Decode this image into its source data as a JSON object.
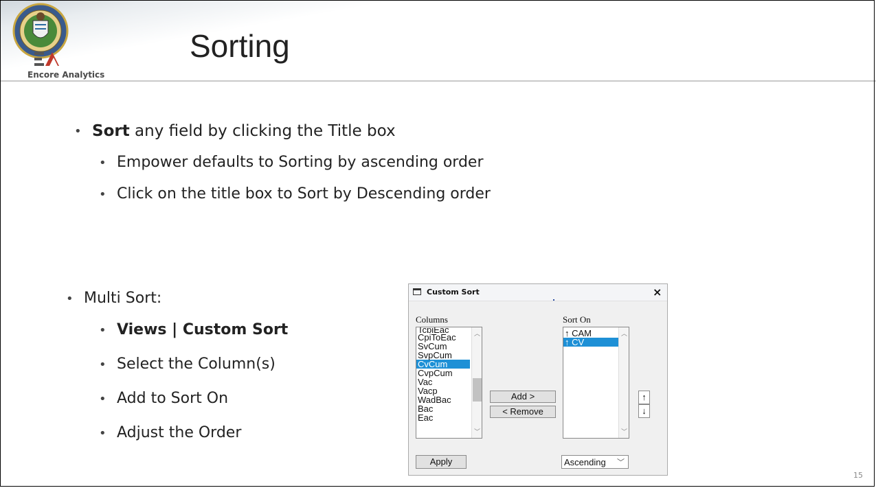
{
  "slide": {
    "title": "Sorting",
    "logo_text": "Encore Analytics",
    "page_number": "15"
  },
  "bullets": {
    "sort_bold": "Sort",
    "sort_rest": " any field by clicking the Title box",
    "sub1": "Empower defaults to Sorting by ascending order",
    "sub2": "Click on the title box to Sort by Descending order",
    "multi": "Multi Sort:",
    "views": "Views | Custom Sort",
    "select_cols": "Select the Column(s)",
    "add_to": "Add to Sort On",
    "adjust": "Adjust the Order"
  },
  "dialog": {
    "title": "Custom Sort",
    "close": "×",
    "columns_label": "Columns",
    "sort_on_label": "Sort On",
    "columns": [
      "CpiToEac",
      "SvCum",
      "SvpCum",
      "CvCum",
      "CvpCum",
      "Vac",
      "Vacp",
      "WadBac",
      "Bac",
      "Eac"
    ],
    "columns_top_clipped": "TcpiEac",
    "selected_column": "CvCum",
    "sort_on": [
      "↑ CAM",
      "↑ CV"
    ],
    "selected_sort": "↑ CV",
    "add_button": "Add >",
    "remove_button": "< Remove",
    "up_button": "↑",
    "down_button": "↓",
    "apply_button": "Apply",
    "order_value": "Ascending"
  },
  "colors": {
    "selection": "#1e90d6",
    "title_text": "#222222"
  }
}
